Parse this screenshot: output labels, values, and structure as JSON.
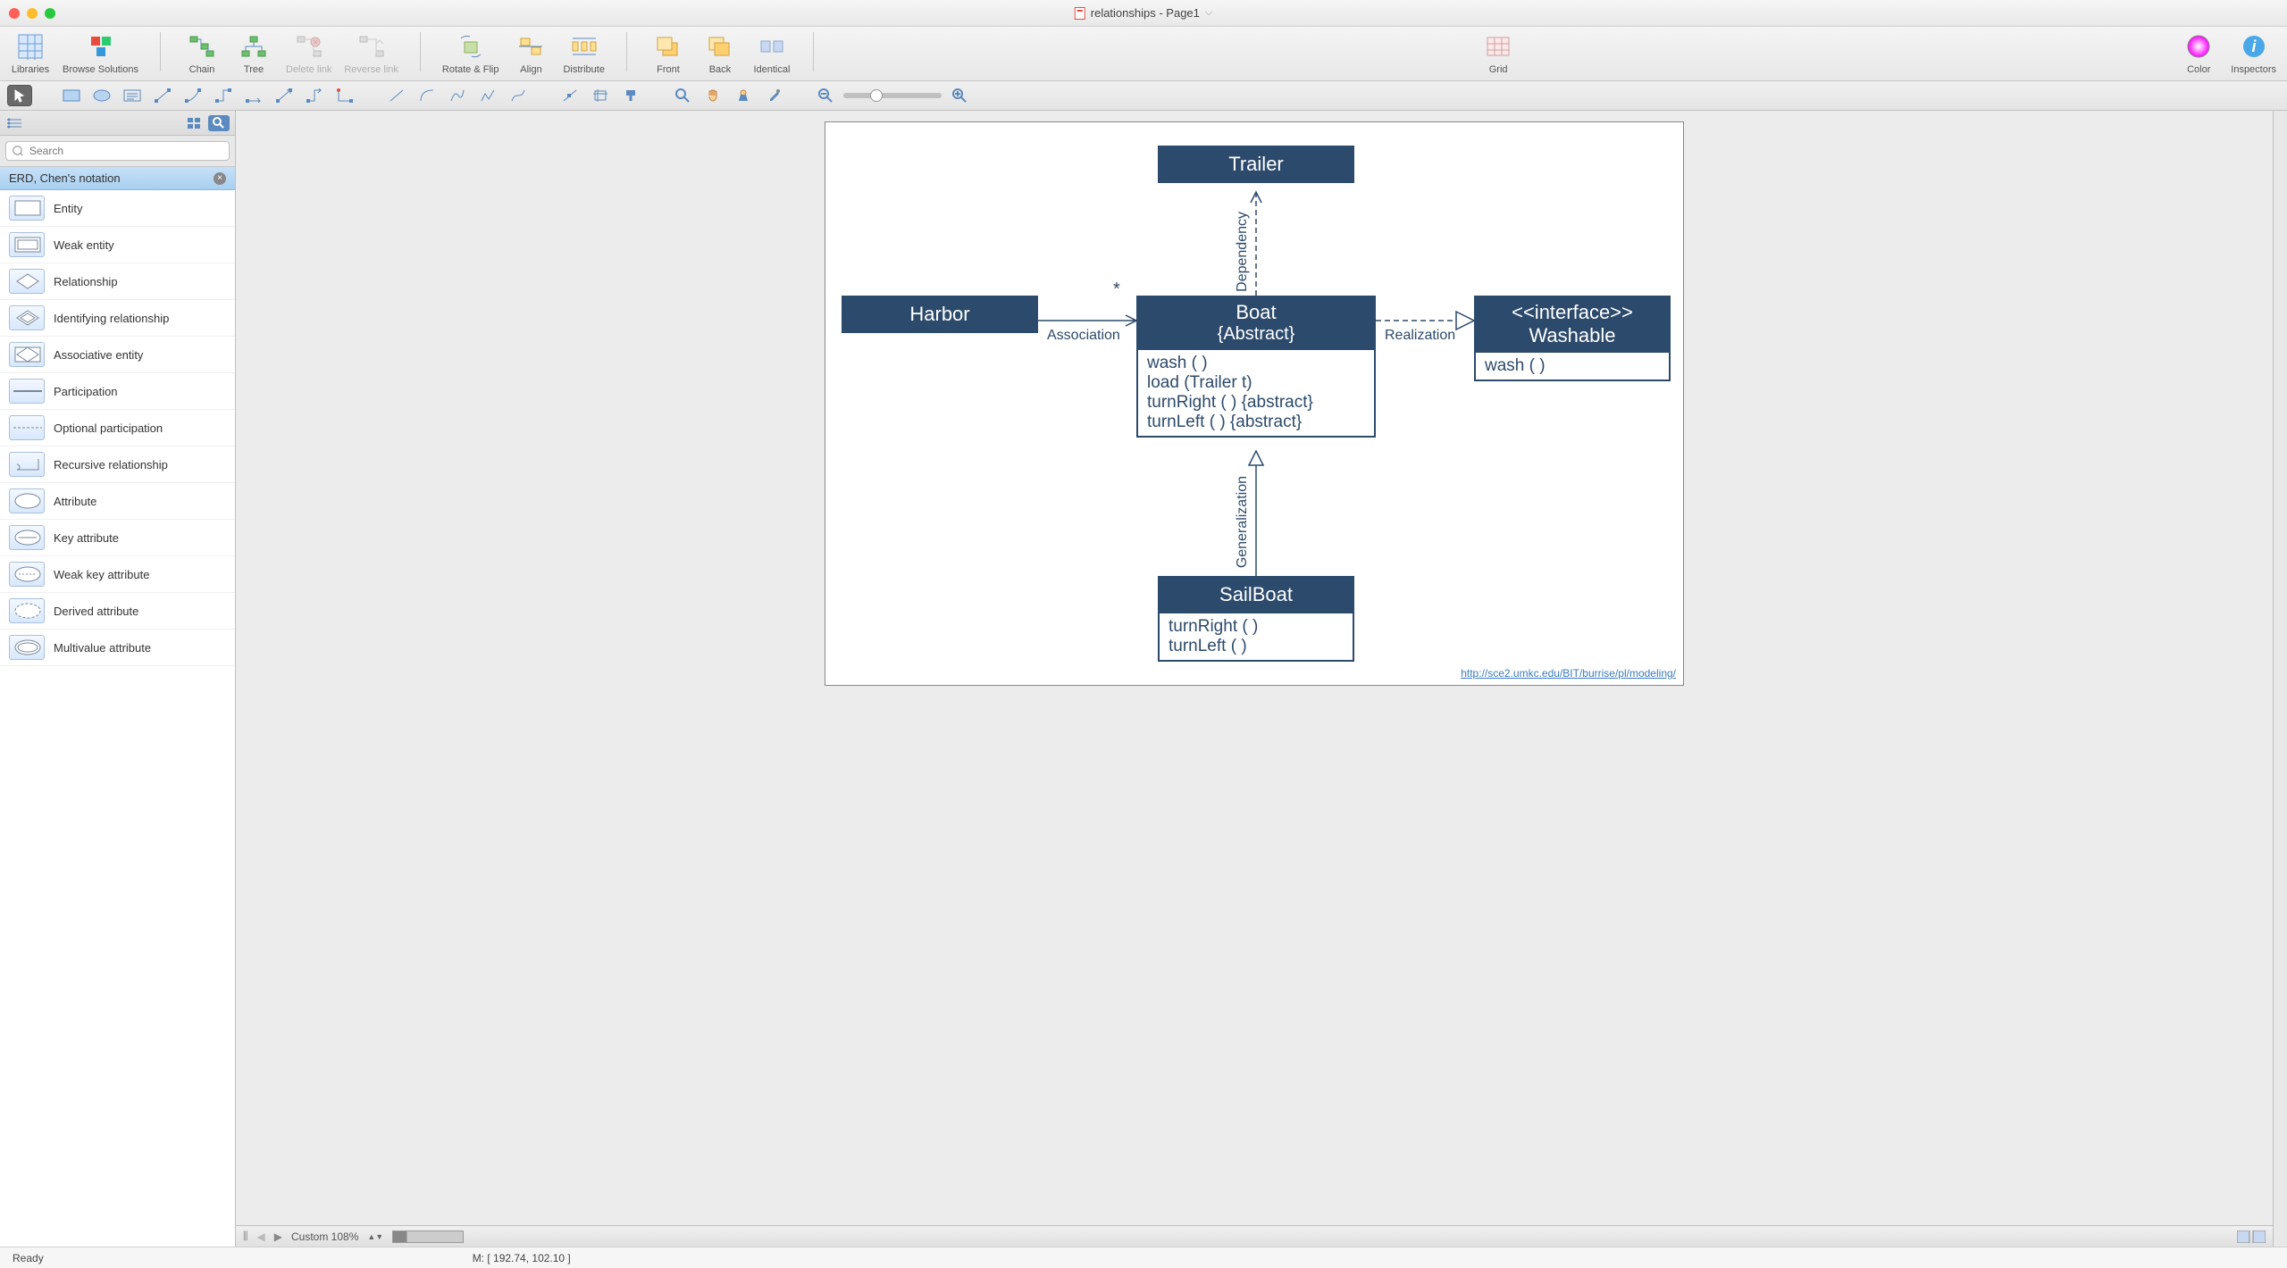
{
  "title": "relationships - Page1",
  "toolbar": {
    "libraries": "Libraries",
    "browse": "Browse Solutions",
    "chain": "Chain",
    "tree": "Tree",
    "deletelink": "Delete link",
    "reverselink": "Reverse link",
    "rotateflip": "Rotate & Flip",
    "align": "Align",
    "distribute": "Distribute",
    "front": "Front",
    "back": "Back",
    "identical": "Identical",
    "grid": "Grid",
    "color": "Color",
    "inspectors": "Inspectors"
  },
  "search": {
    "placeholder": "Search"
  },
  "category": "ERD, Chen's notation",
  "shapes": [
    {
      "label": "Entity"
    },
    {
      "label": "Weak entity"
    },
    {
      "label": "Relationship"
    },
    {
      "label": "Identifying relationship"
    },
    {
      "label": "Associative entity"
    },
    {
      "label": "Participation"
    },
    {
      "label": "Optional participation"
    },
    {
      "label": "Recursive relationship"
    },
    {
      "label": "Attribute"
    },
    {
      "label": "Key attribute"
    },
    {
      "label": "Weak key attribute"
    },
    {
      "label": "Derived attribute"
    },
    {
      "label": "Multivalue attribute"
    }
  ],
  "diagram": {
    "trailer": {
      "title": "Trailer"
    },
    "harbor": {
      "title": "Harbor"
    },
    "boat": {
      "title": "Boat",
      "subtitle": "{Abstract}",
      "ops": [
        "wash ( )",
        "load (Trailer t)",
        "turnRight ( ) {abstract}",
        "turnLeft ( ) {abstract}"
      ]
    },
    "washable": {
      "stereo": "<<interface>>",
      "title": "Washable",
      "ops": [
        "wash ( )"
      ]
    },
    "sailboat": {
      "title": "SailBoat",
      "ops": [
        "turnRight ( )",
        "turnLeft ( )"
      ]
    },
    "labels": {
      "dependency": "Dependency",
      "association": "Association",
      "realization": "Realization",
      "generalization": "Generalization",
      "star": "*"
    },
    "linkurl": "http://sce2.umkc.edu/BIT/burrise/pl/modeling/"
  },
  "bottom": {
    "zoom": "Custom 108%"
  },
  "status": {
    "ready": "Ready",
    "mouse": "M: [ 192.74, 102.10 ]"
  }
}
